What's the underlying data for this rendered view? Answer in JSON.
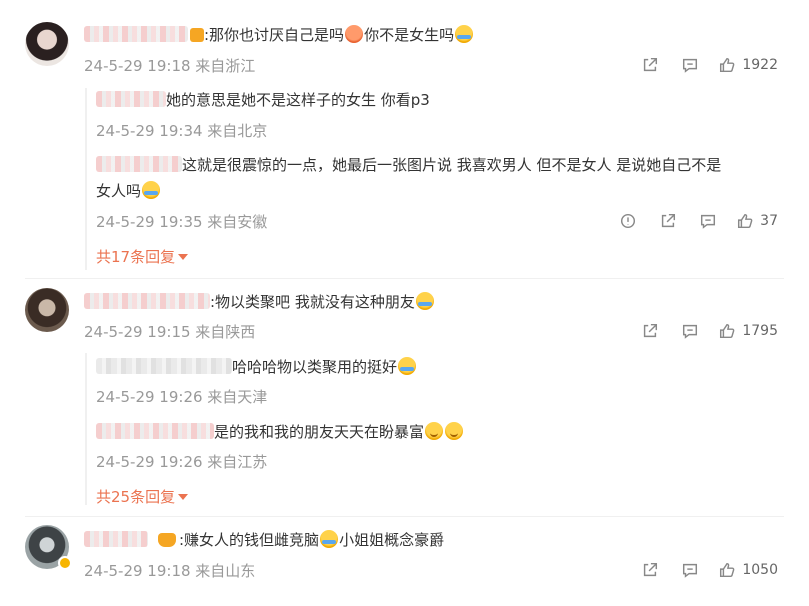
{
  "comments": [
    {
      "text_a": ":那你也讨厌自己是吗",
      "text_b": "你不是女生吗",
      "meta": "24-5-29 19:18 来自浙江",
      "likes": "1922",
      "replies": [
        {
          "text": "她的意思是她不是这样子的女生 你看p3",
          "meta": "24-5-29 19:34 来自北京"
        },
        {
          "text_a": "这就是很震惊的一点，她最后一张图片说 我喜欢男人 但不是女人 是说她自己不是",
          "text_b": "女人吗",
          "meta": "24-5-29 19:35 来自安徽",
          "likes": "37"
        }
      ],
      "more": "共17条回复"
    },
    {
      "text": ":物以类聚吧 我就没有这种朋友",
      "meta": "24-5-29 19:15 来自陕西",
      "likes": "1795",
      "replies": [
        {
          "text": "哈哈哈物以类聚用的挺好",
          "meta": "24-5-29 19:26 来自天津"
        },
        {
          "text": "是的我和我的朋友天天在盼暴富",
          "meta": "24-5-29 19:26 来自江苏"
        }
      ],
      "more": "共25条回复"
    },
    {
      "text_a": ":赚女人的钱但雌竞脑",
      "text_b": "小姐姐概念豪爵",
      "meta": "24-5-29 19:18 来自山东",
      "likes": "1050"
    }
  ]
}
